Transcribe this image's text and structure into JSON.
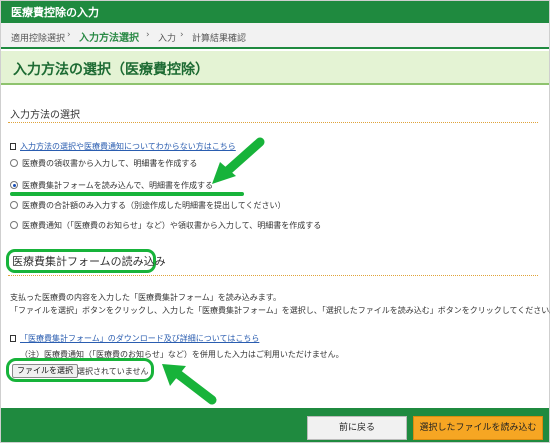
{
  "window": {
    "title": "医療費控除の入力"
  },
  "breadcrumb": {
    "step1": "適用控除選択",
    "step2": "入力方法選択",
    "step3": "入力",
    "step4": "計算結果確認",
    "separator": "›"
  },
  "page": {
    "title": "入力方法の選択（医療費控除）"
  },
  "section_method": {
    "title": "入力方法の選択",
    "help_link": "入力方法の選択や医療費通知についてわからない方はこちら",
    "options": [
      {
        "label": "医療費の領収書から入力して、明細書を作成する",
        "selected": false
      },
      {
        "label": "医療費集計フォームを読み込んで、明細書を作成する",
        "selected": true
      },
      {
        "label": "医療費の合計額のみ入力する（別途作成した明細書を提出してください）",
        "selected": false
      },
      {
        "label": "医療費通知（「医療費のお知らせ」など）や領収書から入力して、明細書を作成する",
        "selected": false
      }
    ]
  },
  "section_form": {
    "title": "医療費集計フォームの読み込み",
    "text1": "支払った医療費の内容を入力した「医療費集計フォーム」を読み込みます。",
    "text2": "「ファイルを選択」ボタンをクリックし、入力した「医療費集計フォーム」を選択し、「選択したファイルを読み込む」ボタンをクリックしてください。",
    "download_link": "「医療費集計フォーム」のダウンロード及び詳細についてはこちら",
    "note": "（注）医療費通知（「医療費のお知らせ」など）を併用した入力はご利用いただけません。",
    "file_button": "ファイルを選択",
    "file_status": "選択されていません"
  },
  "footer": {
    "back": "前に戻る",
    "load": "選択したファイルを読み込む"
  },
  "colors": {
    "header_green": "#1f8a3f",
    "annotation_green": "#17b33a",
    "primary_button": "#f6a623"
  }
}
